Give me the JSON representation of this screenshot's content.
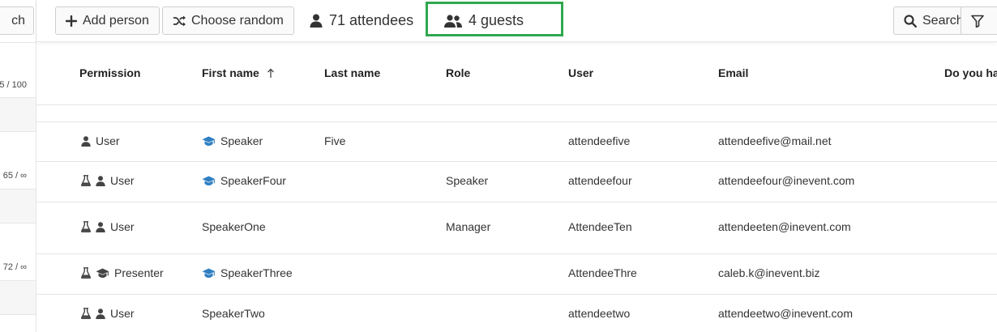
{
  "left_panel": {
    "button_label": "ch",
    "values": [
      "5 / 100",
      "65 / ∞",
      "72 / ∞"
    ]
  },
  "toolbar": {
    "add_person_label": "Add person",
    "choose_random_label": "Choose random",
    "attendees_label": "71 attendees",
    "guests_label": "4 guests",
    "search_label": "Search"
  },
  "table": {
    "columns": [
      "Permission",
      "First name",
      "Last name",
      "Role",
      "User",
      "Email",
      "Do you hav"
    ],
    "rows": [
      {
        "permission": "User",
        "first_name": "Speaker",
        "last_name": "Five",
        "role": "",
        "user": "attendeefive",
        "email": "attendeefive@mail.net"
      },
      {
        "permission": "User",
        "first_name": "SpeakerFour",
        "last_name": "",
        "role": "Speaker",
        "user": "attendeefour",
        "email": "attendeefour@inevent.com"
      },
      {
        "permission": "User",
        "first_name": "SpeakerOne",
        "last_name": "",
        "role": "Manager",
        "user": "AttendeeTen",
        "email": "attendeeten@inevent.com"
      },
      {
        "permission": "Presenter",
        "first_name": "SpeakerThree",
        "last_name": "",
        "role": "",
        "user": "AttendeeThre",
        "email": "caleb.k@inevent.biz"
      },
      {
        "permission": "User",
        "first_name": "SpeakerTwo",
        "last_name": "",
        "role": "",
        "user": "attendeetwo",
        "email": "attendeetwo@inevent.com"
      }
    ]
  },
  "colors": {
    "accent_blue": "#2f7fc1",
    "highlight_green": "#2fa84f",
    "icon_dark": "#444444"
  }
}
